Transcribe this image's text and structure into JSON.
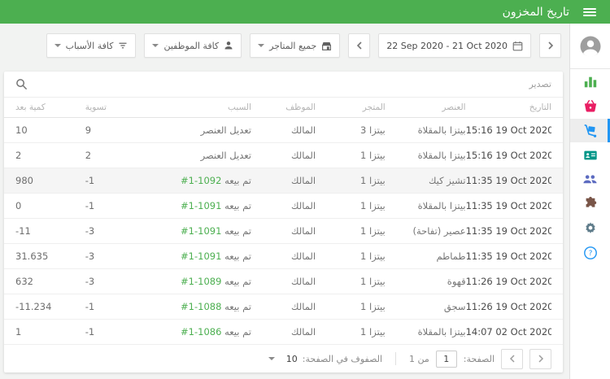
{
  "header": {
    "title": "تاريخ المخزون",
    "menu_icon": "hamburger-icon"
  },
  "theme": {
    "accent_green": "#4caf50",
    "accent_blue": "#2196f3",
    "link_green": "#4caf50"
  },
  "filters": {
    "date_range": "22 Sep 2020 - 21 Oct 2020",
    "stores_label": "جميع المتاجر",
    "employees_label": "كافة الموظفين",
    "reasons_label": "كافة الأسباب",
    "icons": [
      "chevron-right-icon",
      "calendar-icon",
      "chevron-left-icon",
      "store-icon",
      "person-icon",
      "filter-icon"
    ]
  },
  "toolbar": {
    "export_label": "تصدير",
    "search_icon": "search-icon"
  },
  "table": {
    "headers": {
      "date": "التاريخ",
      "item": "العنصر",
      "store": "المتجر",
      "employee": "الموظف",
      "reason": "السبب",
      "adjustment": "تسوية",
      "stock_after": "كمية بعد"
    },
    "rows": [
      {
        "date": "15:16 19 Oct 2020",
        "item": "بيتزا بالمقلاة",
        "store": "بيتزا 3",
        "employee": "المالك",
        "reason": "تعديل العنصر",
        "reason_link": "",
        "adjustment": "9",
        "stock_after": "10",
        "highlight": false
      },
      {
        "date": "15:16 19 Oct 2020",
        "item": "بيتزا بالمقلاة",
        "store": "بيتزا 1",
        "employee": "المالك",
        "reason": "تعديل العنصر",
        "reason_link": "",
        "adjustment": "2",
        "stock_after": "2",
        "highlight": false
      },
      {
        "date": "11:35 19 Oct 2020",
        "item": "تشيز كيك",
        "store": "بيتزا 1",
        "employee": "المالك",
        "reason": "تم بيعه",
        "reason_link": "#1-1092",
        "adjustment": "-1",
        "stock_after": "980",
        "highlight": true
      },
      {
        "date": "11:35 19 Oct 2020",
        "item": "بيتزا بالمقلاة",
        "store": "بيتزا 1",
        "employee": "المالك",
        "reason": "تم بيعه",
        "reason_link": "#1-1091",
        "adjustment": "-1",
        "stock_after": "0",
        "highlight": false
      },
      {
        "date": "11:35 19 Oct 2020",
        "item": "عصير (تفاحة)",
        "store": "بيتزا 1",
        "employee": "المالك",
        "reason": "تم بيعه",
        "reason_link": "#1-1091",
        "adjustment": "-3",
        "stock_after": "-11",
        "highlight": false
      },
      {
        "date": "11:35 19 Oct 2020",
        "item": "طماطم",
        "store": "بيتزا 1",
        "employee": "المالك",
        "reason": "تم بيعه",
        "reason_link": "#1-1091",
        "adjustment": "-3",
        "stock_after": "31.635",
        "highlight": false
      },
      {
        "date": "11:26 19 Oct 2020",
        "item": "قهوة",
        "store": "بيتزا 1",
        "employee": "المالك",
        "reason": "تم بيعه",
        "reason_link": "#1-1089",
        "adjustment": "-3",
        "stock_after": "632",
        "highlight": false
      },
      {
        "date": "11:26 19 Oct 2020",
        "item": "سجق",
        "store": "بيتزا 1",
        "employee": "المالك",
        "reason": "تم بيعه",
        "reason_link": "#1-1088",
        "adjustment": "-1",
        "stock_after": "-11.234",
        "highlight": false
      },
      {
        "date": "14:07 02 Oct 2020",
        "item": "بيتزا بالمقلاة",
        "store": "بيتزا 1",
        "employee": "المالك",
        "reason": "تم بيعه",
        "reason_link": "#1-1086",
        "adjustment": "-1",
        "stock_after": "1",
        "highlight": false
      }
    ]
  },
  "pagination": {
    "page_label": "الصفحة:",
    "page_value": "1",
    "of_label": "من 1",
    "rows_per_page_label": "الصفوف في الصفحة:",
    "rows_per_page_value": "10"
  },
  "sidebar": {
    "active_item": "inventory",
    "items": [
      {
        "name": "account",
        "icon": "account-circle-icon",
        "color": "#9e9e9e"
      },
      {
        "name": "reports",
        "icon": "bar-chart-icon",
        "color": "#4caf50"
      },
      {
        "name": "sales",
        "icon": "basket-icon",
        "color": "#e91e63"
      },
      {
        "name": "inventory",
        "icon": "hand-truck-icon",
        "color": "#2196f3"
      },
      {
        "name": "customers",
        "icon": "contact-card-icon",
        "color": "#009688"
      },
      {
        "name": "employees",
        "icon": "people-icon",
        "color": "#5c6bc0"
      },
      {
        "name": "apps",
        "icon": "puzzle-icon",
        "color": "#795548"
      },
      {
        "name": "settings",
        "icon": "gear-icon",
        "color": "#607d8b"
      },
      {
        "name": "help",
        "icon": "help-icon",
        "color": "#2196f3"
      }
    ]
  }
}
